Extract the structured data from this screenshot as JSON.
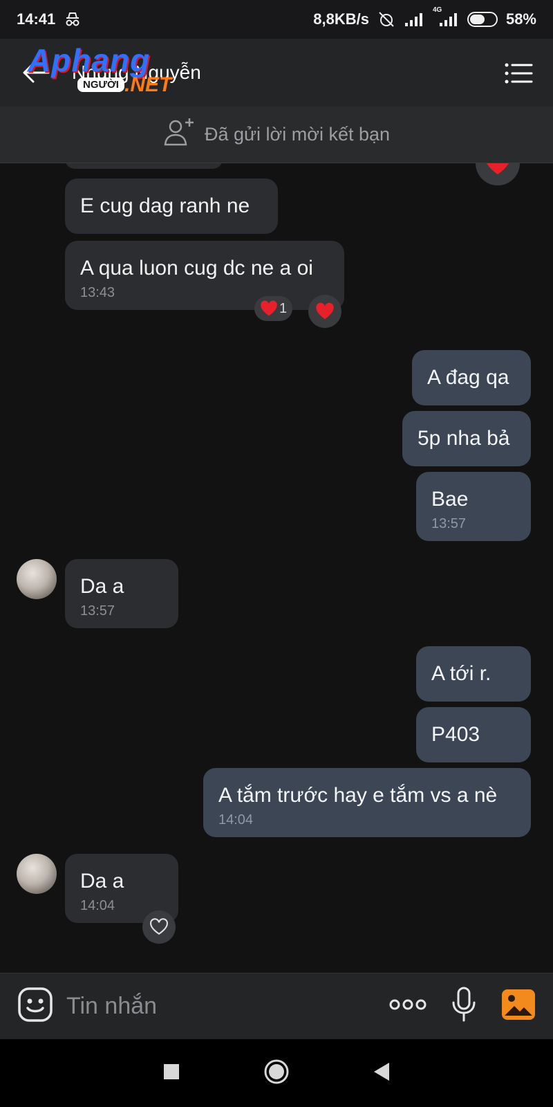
{
  "status_bar": {
    "time": "14:41",
    "network_speed": "8,8KB/s",
    "signal_label": "4G",
    "battery_percent": "58%",
    "battery_level": 0.58
  },
  "header": {
    "contact_name": "Nhung Nguyễn",
    "watermark": {
      "brand": "Aphang",
      "sub": "NGƯỜI",
      "suffix": ".NET"
    }
  },
  "friend_banner": {
    "text": "Đã gửi lời mời kết bạn"
  },
  "messages": [
    {
      "text": "E cug dag ranh ne",
      "time": ""
    },
    {
      "text": "A qua luon cug dc ne a oi",
      "time": "13:43",
      "reaction_count": "1"
    },
    {
      "text": "A đag qa",
      "time": ""
    },
    {
      "text": "5p nha bả",
      "time": ""
    },
    {
      "text": "Bae",
      "time": "13:57"
    },
    {
      "text": "Da a",
      "time": "13:57"
    },
    {
      "text": "A tới r.",
      "time": ""
    },
    {
      "text": "P403",
      "time": ""
    },
    {
      "text": "A tắm trước hay e tắm vs a nè",
      "time": "14:04"
    },
    {
      "text": "Da a",
      "time": "14:04"
    }
  ],
  "composer": {
    "placeholder": "Tin nhắn"
  },
  "colors": {
    "incoming": "#2c2d30",
    "outgoing": "#3c4654",
    "heart": "#e8202a",
    "gallery": "#f28a1e"
  }
}
